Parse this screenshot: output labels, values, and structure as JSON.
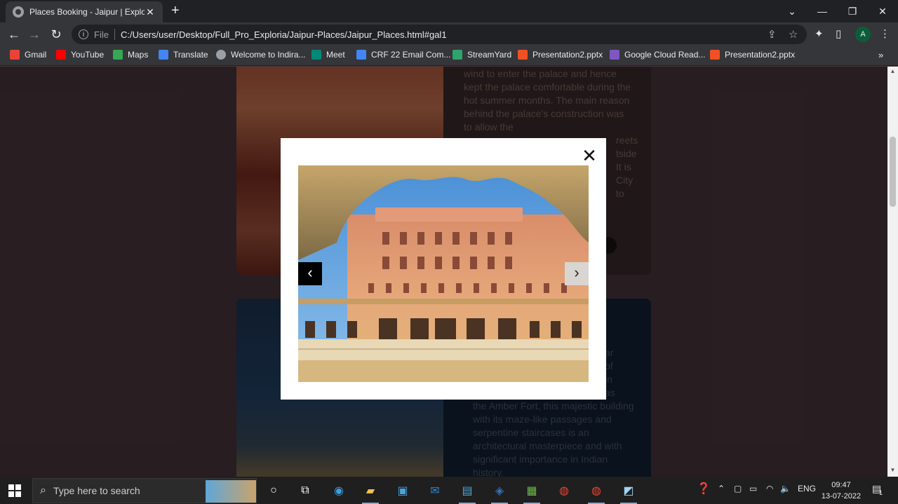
{
  "browser": {
    "tab_title": "Places Booking - Jaipur | Exploria",
    "tab_close": "✕",
    "new_tab": "+",
    "window_controls": {
      "dropdown": "⌄",
      "minimize": "—",
      "restore": "❐",
      "close": "✕"
    },
    "nav": {
      "back": "←",
      "forward": "→",
      "reload": "↻"
    },
    "scheme_label": "File",
    "url": "C:/Users/user/Desktop/Full_Pro_Exploria/Jaipur-Places/Jaipur_Places.html#gal1",
    "profile_initial": "A"
  },
  "bookmarks": [
    {
      "label": "Gmail",
      "color": "#ea4335"
    },
    {
      "label": "YouTube",
      "color": "#ff0000"
    },
    {
      "label": "Maps",
      "color": "#34a853"
    },
    {
      "label": "Translate",
      "color": "#4285f4"
    },
    {
      "label": "Welcome to Indira...",
      "color": "#9aa0a6"
    },
    {
      "label": "Meet",
      "color": "#00897b"
    },
    {
      "label": "CRF 22 Email Com...",
      "color": "#4285f4"
    },
    {
      "label": "StreamYard",
      "color": "#2ea36b"
    },
    {
      "label": "Presentation2.pptx",
      "color": "#f25022"
    },
    {
      "label": "Google Cloud Read...",
      "color": "#7e57c2"
    },
    {
      "label": "Presentation2.pptx",
      "color": "#f25022"
    }
  ],
  "bookmarks_more": "»",
  "page": {
    "card1_text": "wind to enter the palace and hence kept the palace comfortable during the hot summer months. The main reason behind the palace's construction was to allow the",
    "card1_text_right": "reets\ntside\nIt is\nCity\nto",
    "card2_text": "the Amber Fort, this majestic building with its maze-like passages and serpentine staircases is an architectural masterpiece and with significant importance in Indian history.",
    "card2_text_right": "ar\nof\nin\nas"
  },
  "modal": {
    "close": "✕",
    "prev": "‹",
    "next": "›",
    "photo_subject": "Hawa Mahal facade viewed through an arch"
  },
  "scrollbar": {
    "up": "▲",
    "down": "▼"
  },
  "taskbar": {
    "search_placeholder": "Type here to search",
    "language": "ENG",
    "time": "09:47",
    "date": "13-07-2022",
    "notification_count": "1"
  },
  "colors": {
    "page_bg": "#4a363d",
    "modal_bg": "#ffffff",
    "prev_button": "#000000",
    "next_button": "#d9d6d2"
  }
}
